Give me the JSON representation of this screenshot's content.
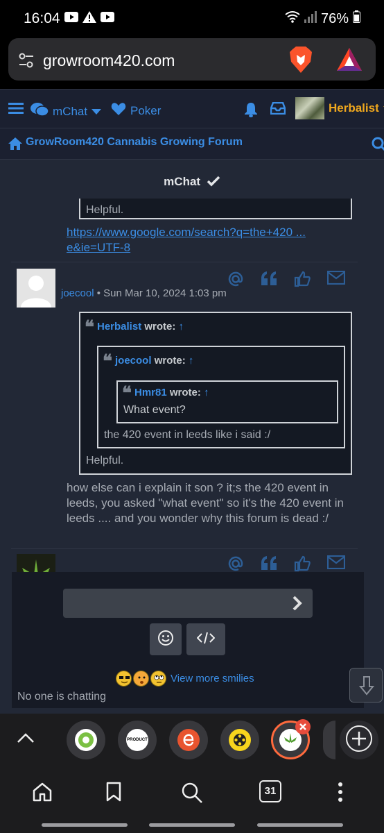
{
  "status_bar": {
    "time": "16:04",
    "battery": "76%",
    "icons": [
      "youtube-icon",
      "alert-icon",
      "youtube-icon",
      "wifi-icon",
      "signal-icon",
      "battery-icon"
    ]
  },
  "browser": {
    "url": "growroom420.com",
    "icons": [
      "site-settings-icon",
      "brave-lion-icon",
      "brave-rewards-icon"
    ]
  },
  "forum_nav": {
    "mchat_label": "mChat",
    "poker_label": "Poker",
    "username": "Herbalist"
  },
  "breadcrumb": {
    "title": "GrowRoom420 Cannabis Growing Forum"
  },
  "mchat": {
    "title": "mChat",
    "prev_message": {
      "quote_tail": "Helpful.",
      "link_line1": "https://www.google.com/search?q=the+420 ...",
      "link_line2": "e&ie=UTF-8"
    },
    "message": {
      "author": "joecool",
      "meta": "• Sun Mar 10, 2024 1:03 pm",
      "quote_outer_author": "Herbalist",
      "quote_mid_author": "joecool",
      "quote_inner_author": "Hmr81",
      "wrote": "wrote:",
      "arrow": "↑",
      "quote_inner_text": "What event?",
      "quote_mid_text": "the 420 event in leeds like i said :/",
      "quote_outer_text": "Helpful.",
      "body": "how else can i explain it son ? it;s the 420 event in leeds, you asked \"what event\" so it's the 420 event in leeds .... and you wonder why this forum is dead :/"
    },
    "composer": {
      "input_value": "",
      "view_more_smilies": "View more smilies",
      "status": "No one is chatting"
    }
  },
  "tabs": {
    "active_index": 4,
    "labels": [
      "PRODUCT"
    ],
    "count": "31"
  },
  "colors": {
    "accent_blue": "#3b8de4",
    "username_orange": "#f0a81e",
    "page_bg": "#222836",
    "active_tab_ring": "#ff6a3d"
  }
}
